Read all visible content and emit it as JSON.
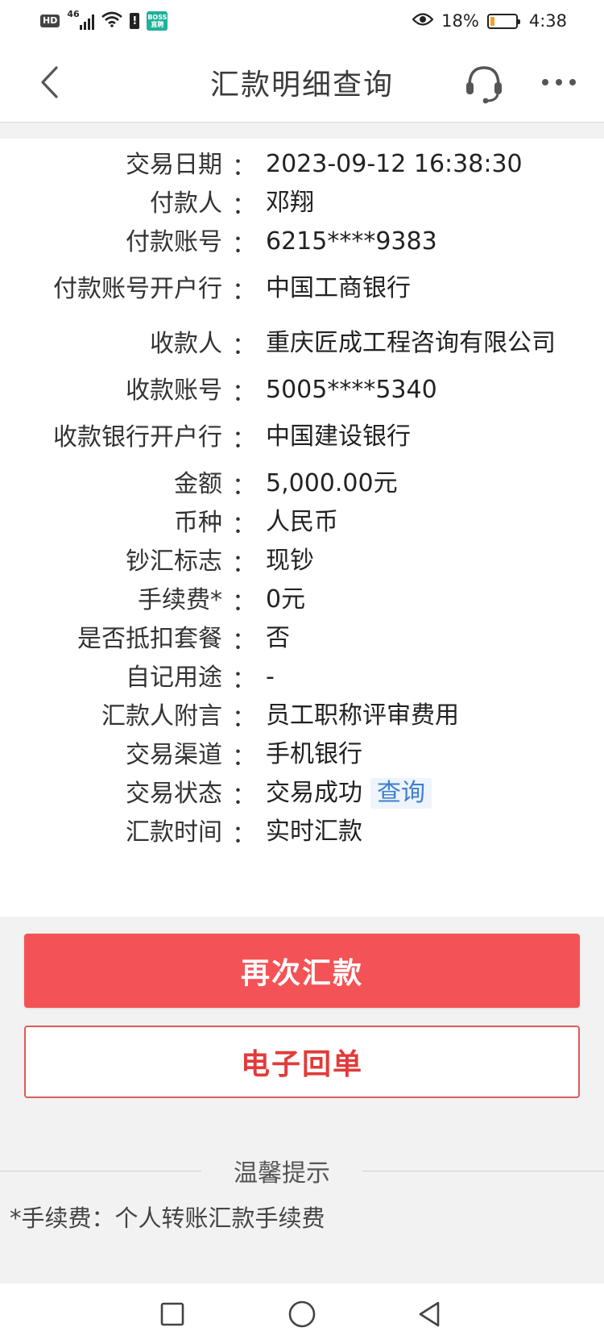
{
  "status_bar": {
    "hd": "HD",
    "network": "46",
    "app_badge": "BOSS\n直聘",
    "battery_percent": "18%",
    "battery_level": 0.18,
    "time": "4:38"
  },
  "header": {
    "title": "汇款明细查询",
    "icons": {
      "back": "chevron-left-icon",
      "service": "headset-icon",
      "more": "more-dots-icon"
    }
  },
  "details": [
    {
      "label": "交易日期",
      "colon": "：",
      "value": "2023-09-12 16:38:30",
      "tall": false
    },
    {
      "label": "付款人",
      "colon": "：",
      "value": "邓翔",
      "tall": false
    },
    {
      "label": "付款账号",
      "colon": "：",
      "value": "6215****9383",
      "tall": false
    },
    {
      "label": "付款账号开户行",
      "colon": "：",
      "value": "中国工商银行",
      "tall": true
    },
    {
      "label": "收款人",
      "colon": "：",
      "value": "重庆匠成工程咨询有限公司",
      "tall": true
    },
    {
      "label": "收款账号",
      "colon": "：",
      "value": "5005****5340",
      "tall": false
    },
    {
      "label": "收款银行开户行",
      "colon": "：",
      "value": "中国建设银行",
      "tall": true
    },
    {
      "label": "金额",
      "colon": "：",
      "value": "5,000.00元",
      "tall": false
    },
    {
      "label": "币种",
      "colon": "：",
      "value": "人民币",
      "tall": false
    },
    {
      "label": "钞汇标志",
      "colon": "：",
      "value": "现钞",
      "tall": false
    },
    {
      "label": "手续费*",
      "colon": "：",
      "value": "0元",
      "tall": false
    },
    {
      "label": "是否抵扣套餐",
      "colon": "：",
      "value": "否",
      "tall": false
    },
    {
      "label": "自记用途",
      "colon": "：",
      "value": "-",
      "tall": false
    },
    {
      "label": "汇款人附言",
      "colon": "：",
      "value": "员工职称评审费用",
      "tall": false
    },
    {
      "label": "交易渠道",
      "colon": "：",
      "value": "手机银行",
      "tall": false
    },
    {
      "label": "交易状态",
      "colon": "：",
      "value": "交易成功",
      "tall": false,
      "action": "查询"
    },
    {
      "label": "汇款时间",
      "colon": "：",
      "value": "实时汇款",
      "tall": false
    }
  ],
  "buttons": {
    "remit_again": "再次汇款",
    "e_receipt": "电子回单"
  },
  "tips": {
    "title": "温馨提示",
    "text": "*手续费：个人转账汇款手续费"
  },
  "colors": {
    "primary_red": "#f35356",
    "link_blue": "#3f7fcf"
  }
}
